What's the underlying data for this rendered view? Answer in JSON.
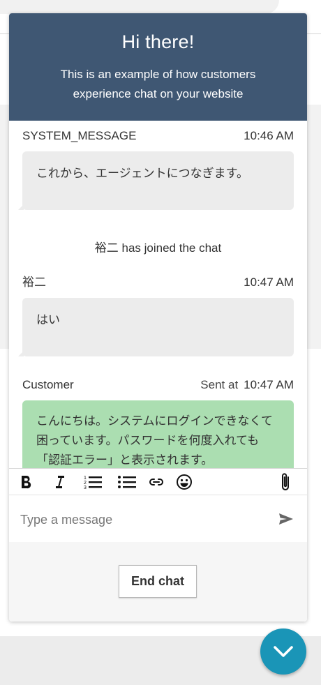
{
  "header": {
    "title": "Hi there!",
    "subtitle": "This is an example of how customers experience chat on your website"
  },
  "transcript": {
    "messages": [
      {
        "sender": "SYSTEM_MESSAGE",
        "time": "10:46 AM",
        "text": "これから、エージェントにつなぎます。"
      },
      {
        "event": "裕二 has joined the chat"
      },
      {
        "sender": "裕二",
        "time": "10:47 AM",
        "text": "はい"
      },
      {
        "sender": "Customer",
        "sent_label": "Sent at",
        "time": "10:47 AM",
        "text": "こんにちは。システムにログインできなくて困っています。パスワードを何度入れても「認証エラー」と表示されます。"
      }
    ]
  },
  "toolbar": {
    "tools": [
      "bold-icon",
      "italic-icon",
      "numbered-list-icon",
      "bulleted-list-icon",
      "link-icon",
      "emoji-icon",
      "attachment-icon"
    ]
  },
  "composer": {
    "placeholder": "Type a message",
    "value": ""
  },
  "footer": {
    "end_chat_label": "End chat"
  },
  "colors": {
    "header_bg": "#3f5773",
    "customer_bubble": "#abdeb1",
    "agent_bubble": "#ececec",
    "fab": "#1a95b7"
  }
}
